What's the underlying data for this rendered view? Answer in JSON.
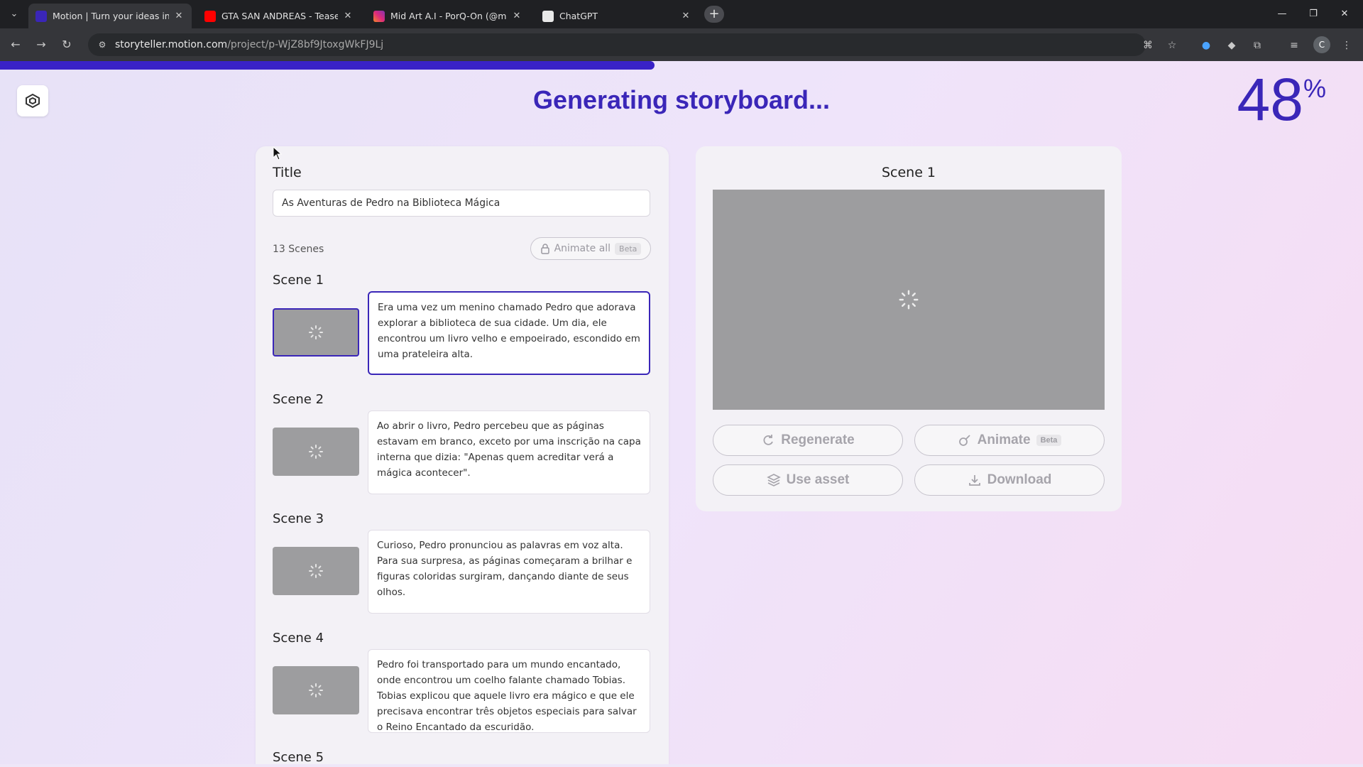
{
  "browser": {
    "tabs": [
      {
        "title": "Motion | Turn your ideas into",
        "favicon_color": "#3a26b8",
        "active": true
      },
      {
        "title": "GTA SAN ANDREAS - Teaser Tra",
        "favicon_color": "#ff0000",
        "active": false
      },
      {
        "title": "Mid Art A.I - PorQ-On (@midar",
        "favicon_color": "#d6249f",
        "active": false
      },
      {
        "title": "ChatGPT",
        "favicon_color": "#e8e8e8",
        "active": false
      }
    ],
    "url_host": "storyteller.motion.com",
    "url_path": "/project/p-WjZ8bf9JtoxgWkFJ9Lj",
    "profile_initial": "C"
  },
  "header": {
    "heading": "Generating storyboard...",
    "percent": "48",
    "percent_sign": "%",
    "progress": 0.48
  },
  "story": {
    "title_label": "Title",
    "title_value": "As Aventuras de Pedro na Biblioteca Mágica",
    "scene_count": "13 Scenes",
    "animate_all_label": "Animate all",
    "beta_label": "Beta",
    "scenes": [
      {
        "name": "Scene 1",
        "text": "Era uma vez um menino chamado Pedro que adorava explorar a biblioteca de sua cidade. Um dia, ele encontrou um livro velho e empoeirado, escondido em uma prateleira alta."
      },
      {
        "name": "Scene 2",
        "text": "Ao abrir o livro, Pedro percebeu que as páginas estavam em branco, exceto por uma inscrição na capa interna que dizia: \"Apenas quem acreditar verá a mágica acontecer\"."
      },
      {
        "name": "Scene 3",
        "text": "Curioso, Pedro pronunciou as palavras em voz alta. Para sua surpresa, as páginas começaram a brilhar e figuras coloridas surgiram, dançando diante de seus olhos."
      },
      {
        "name": "Scene 4",
        "text": "Pedro foi transportado para um mundo encantado, onde encontrou um coelho falante chamado Tobias. Tobias explicou que aquele livro era mágico e que ele precisava encontrar três objetos especiais para salvar o Reino Encantado da escuridão."
      },
      {
        "name": "Scene 5",
        "text": ""
      }
    ]
  },
  "preview": {
    "title": "Scene 1",
    "regenerate_label": "Regenerate",
    "animate_label": "Animate",
    "beta_label": "Beta",
    "use_asset_label": "Use asset",
    "download_label": "Download"
  },
  "colors": {
    "accent": "#3a26b8",
    "progress": "#3922c7",
    "placeholder": "#9d9d9f"
  }
}
